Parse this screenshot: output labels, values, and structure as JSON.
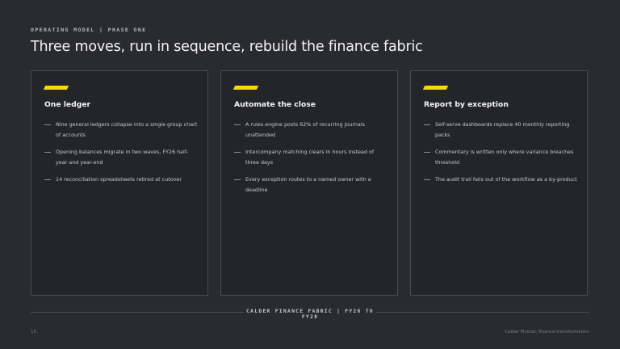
{
  "header": {
    "eyebrow": "OPERATING MODEL | PHASE ONE",
    "title": "Three moves, run in sequence, rebuild the finance fabric"
  },
  "colors": {
    "background": "#2a2b31",
    "card": "#24252b",
    "accent": "#f5d90a"
  },
  "cards": [
    {
      "title": "One ledger",
      "bullets": [
        "Nine general ledgers collapse into a single group chart of accounts",
        "Opening balances migrate in two waves, FY26 half-year and year-end",
        "14 reconciliation spreadsheets retired at cutover"
      ]
    },
    {
      "title": "Automate the close",
      "bullets": [
        "A rules engine posts 62% of recurring journals unattended",
        "Intercompany matching clears in hours instead of three days",
        "Every exception routes to a named owner with a deadline"
      ]
    },
    {
      "title": "Report by exception",
      "bullets": [
        "Self-serve dashboards replace 40 monthly reporting packs",
        "Commentary is written only where variance breaches threshold",
        "The audit trail falls out of the workflow as a by-product"
      ]
    }
  ],
  "footer": {
    "label": "CALDER FINANCE FABRIC | FY26 TO FY28",
    "page_number": "15",
    "credit": "Calder Mutual, finance transformation"
  }
}
